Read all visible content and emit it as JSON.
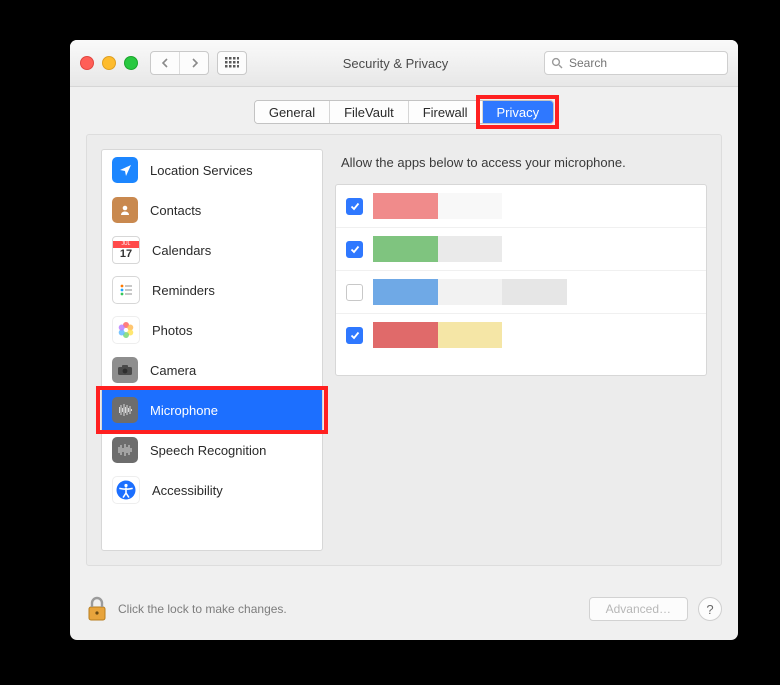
{
  "window": {
    "title": "Security & Privacy"
  },
  "search": {
    "placeholder": "Search"
  },
  "tabs": [
    {
      "label": "General",
      "active": false
    },
    {
      "label": "FileVault",
      "active": false
    },
    {
      "label": "Firewall",
      "active": false
    },
    {
      "label": "Privacy",
      "active": true
    }
  ],
  "sidebar": {
    "items": [
      {
        "label": "Location Services",
        "icon": "location-icon",
        "selected": false
      },
      {
        "label": "Contacts",
        "icon": "contacts-icon",
        "selected": false
      },
      {
        "label": "Calendars",
        "icon": "calendar-icon",
        "selected": false
      },
      {
        "label": "Reminders",
        "icon": "reminders-icon",
        "selected": false
      },
      {
        "label": "Photos",
        "icon": "photos-icon",
        "selected": false
      },
      {
        "label": "Camera",
        "icon": "camera-icon",
        "selected": false
      },
      {
        "label": "Microphone",
        "icon": "microphone-icon",
        "selected": true
      },
      {
        "label": "Speech Recognition",
        "icon": "speech-icon",
        "selected": false
      },
      {
        "label": "Accessibility",
        "icon": "accessibility-icon",
        "selected": false
      }
    ]
  },
  "main": {
    "heading": "Allow the apps below to access your microphone.",
    "apps": [
      {
        "checked": true,
        "colors": [
          "#f08b8b",
          "#f8f8f8",
          "#ffffff",
          "#ffffff",
          "#ffffff"
        ]
      },
      {
        "checked": true,
        "colors": [
          "#7fc47f",
          "#eaeaea",
          "#ffffff",
          "#ffffff",
          "#ffffff"
        ]
      },
      {
        "checked": false,
        "colors": [
          "#6fa9e6",
          "#f2f2f2",
          "#e6e6e6",
          "#ffffff",
          "#ffffff"
        ]
      },
      {
        "checked": true,
        "colors": [
          "#e06a6a",
          "#f5e6a6",
          "#ffffff",
          "#ffffff",
          "#ffffff"
        ]
      }
    ]
  },
  "footer": {
    "lock_text": "Click the lock to make changes.",
    "advanced_label": "Advanced…"
  },
  "highlights": [
    {
      "target": "tab-privacy"
    },
    {
      "target": "sidebar-item-microphone"
    }
  ]
}
